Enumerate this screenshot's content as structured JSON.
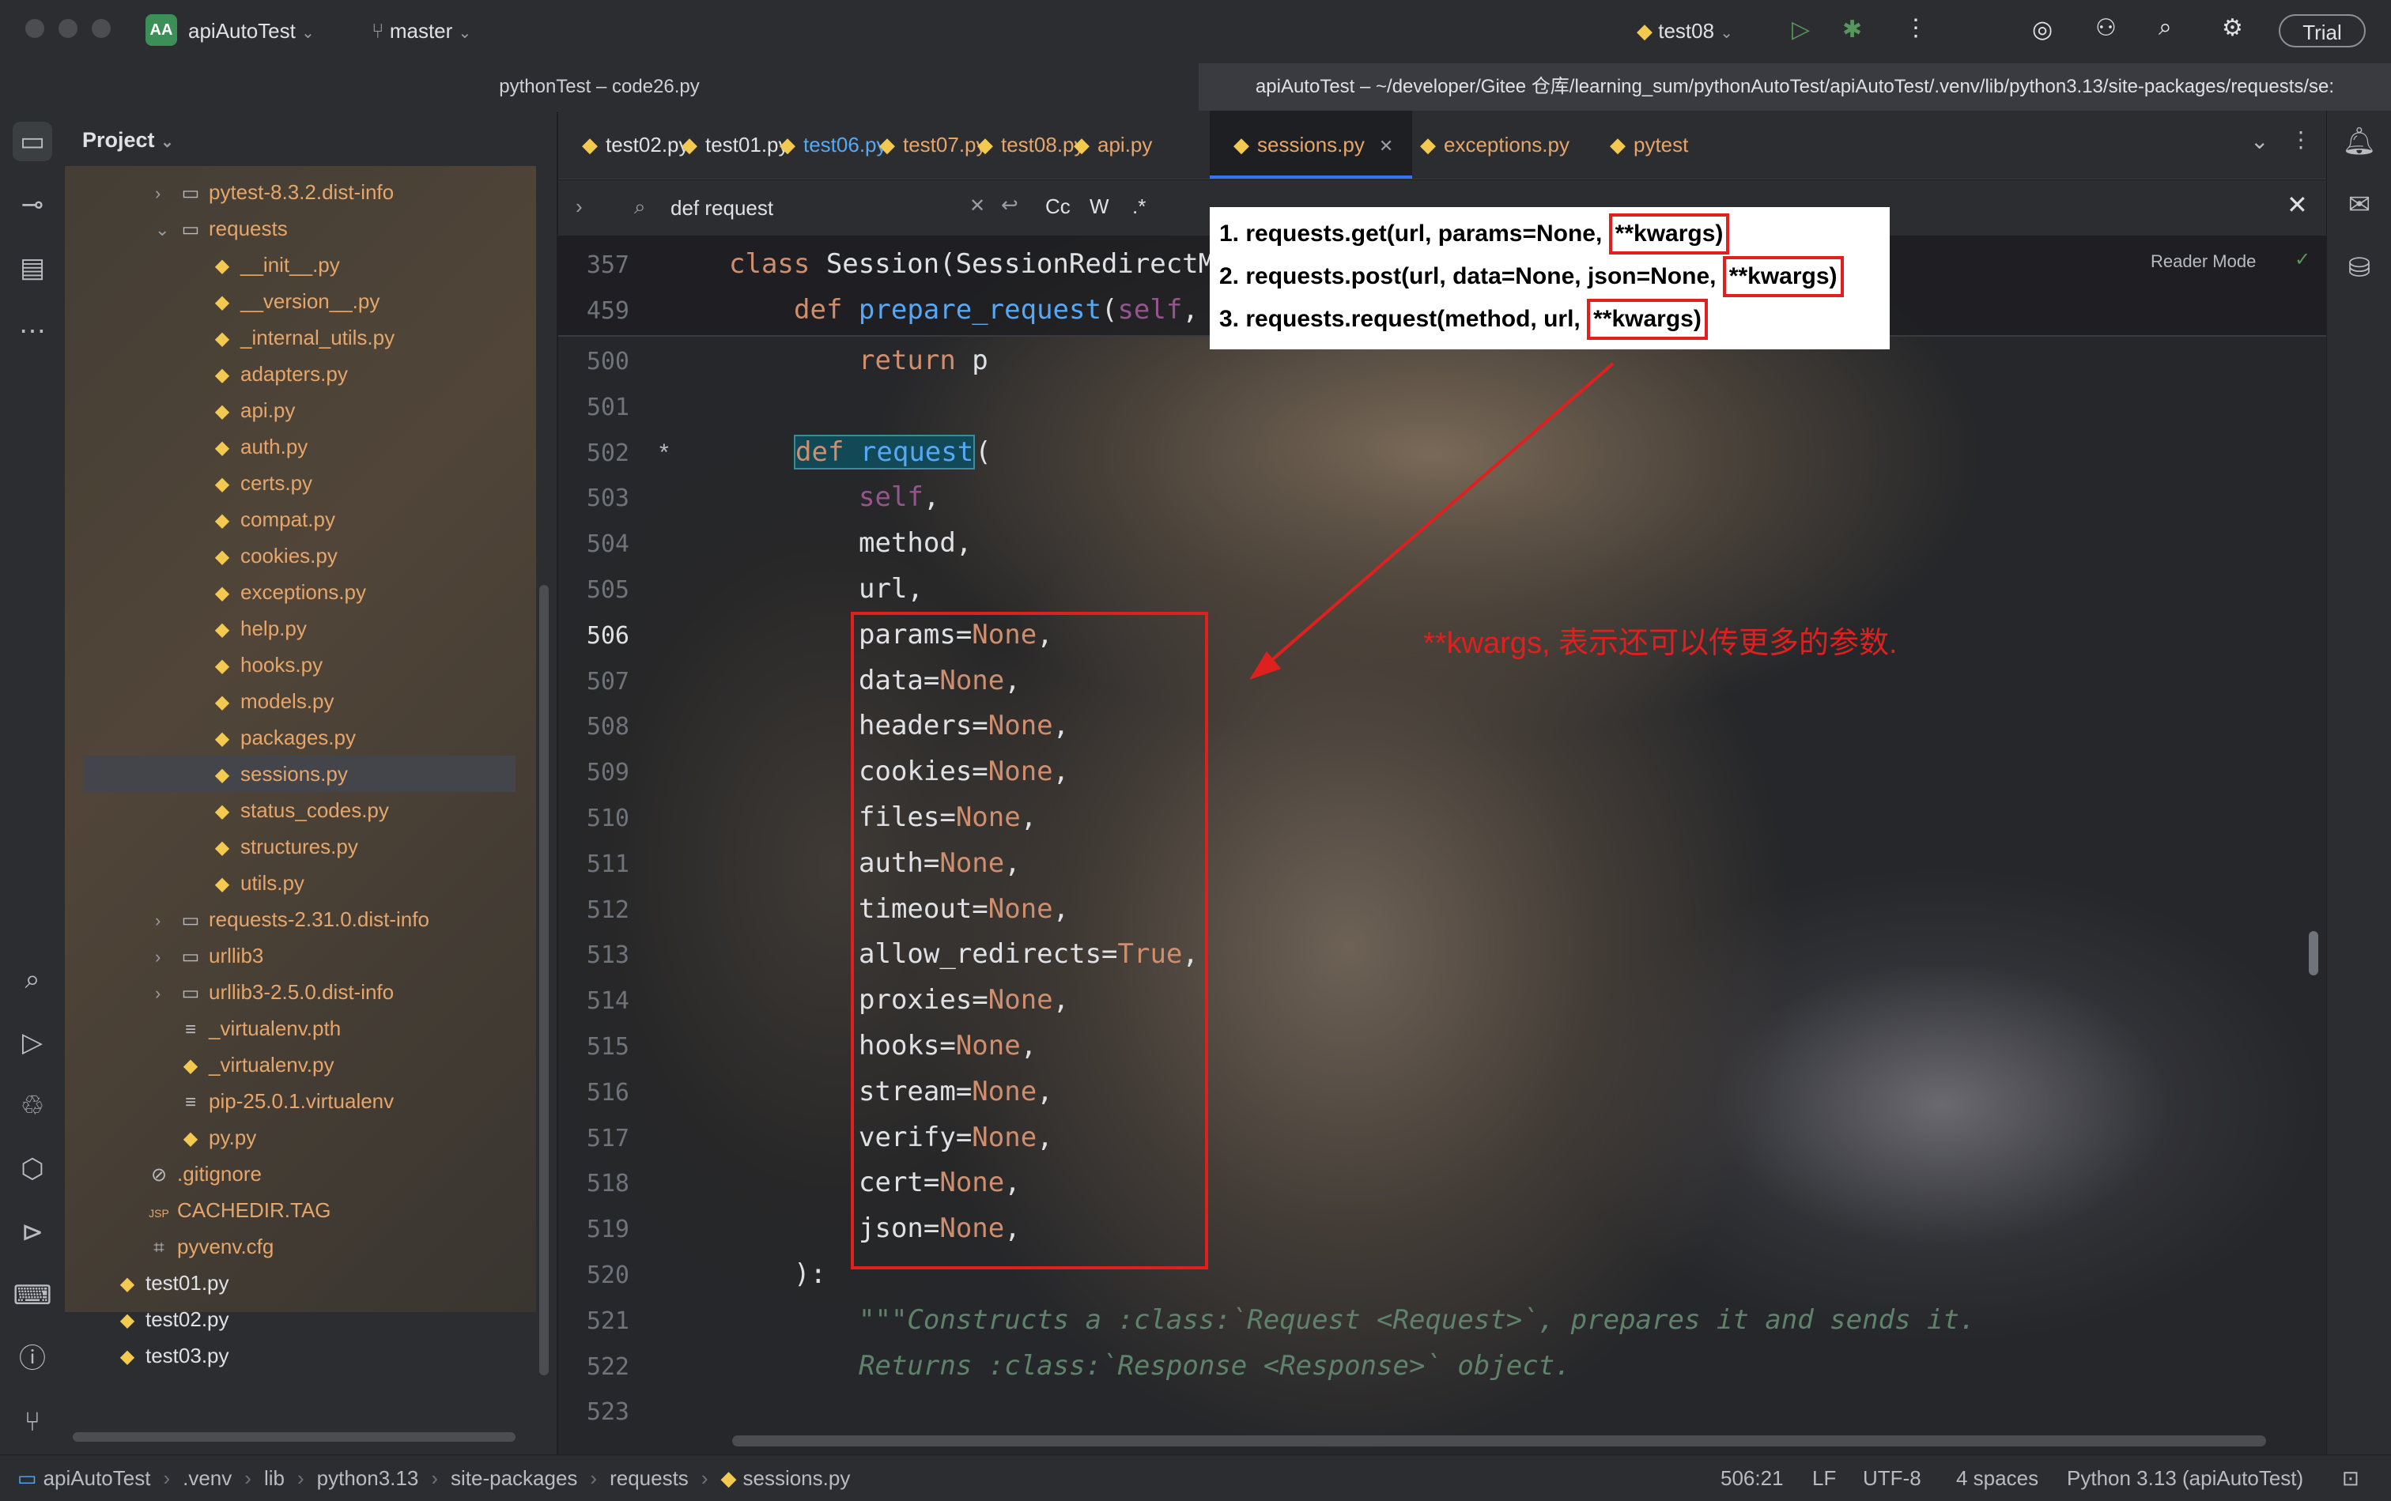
{
  "titlebar": {
    "project_badge": "AA",
    "project_name": "apiAutoTest",
    "branch": "master",
    "run_config": "test08",
    "trial_label": "Trial"
  },
  "window_tabs": [
    "pythonTest – code26.py",
    "apiAutoTest – ~/developer/Gitee 仓库/learning_sum/pythonAutoTest/apiAutoTest/.venv/lib/python3.13/site-packages/requests/se:"
  ],
  "project_panel": {
    "title": "Project",
    "items": [
      {
        "label": "pytest-8.3.2.dist-info",
        "type": "folder",
        "indent": 1,
        "chevron": "›"
      },
      {
        "label": "requests",
        "type": "folder",
        "indent": 1,
        "chevron": "⌄"
      },
      {
        "label": "__init__.py",
        "type": "py",
        "indent": 2
      },
      {
        "label": "__version__.py",
        "type": "py",
        "indent": 2
      },
      {
        "label": "_internal_utils.py",
        "type": "py",
        "indent": 2
      },
      {
        "label": "adapters.py",
        "type": "py",
        "indent": 2
      },
      {
        "label": "api.py",
        "type": "py",
        "indent": 2
      },
      {
        "label": "auth.py",
        "type": "py",
        "indent": 2
      },
      {
        "label": "certs.py",
        "type": "py",
        "indent": 2
      },
      {
        "label": "compat.py",
        "type": "py",
        "indent": 2
      },
      {
        "label": "cookies.py",
        "type": "py",
        "indent": 2
      },
      {
        "label": "exceptions.py",
        "type": "py",
        "indent": 2
      },
      {
        "label": "help.py",
        "type": "py",
        "indent": 2
      },
      {
        "label": "hooks.py",
        "type": "py",
        "indent": 2
      },
      {
        "label": "models.py",
        "type": "py",
        "indent": 2
      },
      {
        "label": "packages.py",
        "type": "py",
        "indent": 2
      },
      {
        "label": "sessions.py",
        "type": "py",
        "indent": 2,
        "selected": true
      },
      {
        "label": "status_codes.py",
        "type": "py",
        "indent": 2
      },
      {
        "label": "structures.py",
        "type": "py",
        "indent": 2
      },
      {
        "label": "utils.py",
        "type": "py",
        "indent": 2
      },
      {
        "label": "requests-2.31.0.dist-info",
        "type": "folder",
        "indent": 1,
        "chevron": "›"
      },
      {
        "label": "urllib3",
        "type": "folder",
        "indent": 1,
        "chevron": "›"
      },
      {
        "label": "urllib3-2.5.0.dist-info",
        "type": "folder",
        "indent": 1,
        "chevron": "›"
      },
      {
        "label": "_virtualenv.pth",
        "type": "text",
        "indent": 1
      },
      {
        "label": "_virtualenv.py",
        "type": "py",
        "indent": 1
      },
      {
        "label": "pip-25.0.1.virtualenv",
        "type": "text",
        "indent": 1
      },
      {
        "label": "py.py",
        "type": "py",
        "indent": 1
      },
      {
        "label": ".gitignore",
        "type": "ignore",
        "indent": 0
      },
      {
        "label": "CACHEDIR.TAG",
        "type": "tag",
        "indent": 0
      },
      {
        "label": "pyvenv.cfg",
        "type": "cfg",
        "indent": 0
      },
      {
        "label": "test01.py",
        "type": "py",
        "indent": -1,
        "white": true
      },
      {
        "label": "test02.py",
        "type": "py",
        "indent": -1,
        "white": true
      },
      {
        "label": "test03.py",
        "type": "py",
        "indent": -1,
        "white": true
      }
    ]
  },
  "editor_tabs": [
    {
      "label": "test02.py",
      "color": "#dfe1e5"
    },
    {
      "label": "test01.py",
      "color": "#dfe1e5"
    },
    {
      "label": "test06.py",
      "color": "#56a8f5"
    },
    {
      "label": "test07.py",
      "color": "#e6a66a"
    },
    {
      "label": "test08.py",
      "color": "#e6a66a"
    },
    {
      "label": "api.py",
      "color": "#e6a66a"
    },
    {
      "label": "sessions.py",
      "color": "#e6a66a",
      "active": true
    },
    {
      "label": "exceptions.py",
      "color": "#e6a66a"
    },
    {
      "label": "pytest",
      "color": "#e6a66a"
    }
  ],
  "find": {
    "query": "def request",
    "opt_case": "Cc",
    "opt_word": "W",
    "opt_regex": ".*"
  },
  "editor": {
    "reader_mode": "Reader Mode",
    "lines": [
      {
        "no": "357",
        "code": "class Session(SessionRedirectM"
      },
      {
        "no": "459",
        "code": "def prepare_request(self,"
      },
      {
        "no": "500",
        "code": "return p"
      },
      {
        "no": "501",
        "code": ""
      },
      {
        "no": "502",
        "code": "def request("
      },
      {
        "no": "503",
        "code": "self,"
      },
      {
        "no": "504",
        "code": "method,"
      },
      {
        "no": "505",
        "code": "url,"
      },
      {
        "no": "506",
        "code": "params=None,"
      },
      {
        "no": "507",
        "code": "data=None,"
      },
      {
        "no": "508",
        "code": "headers=None,"
      },
      {
        "no": "509",
        "code": "cookies=None,"
      },
      {
        "no": "510",
        "code": "files=None,"
      },
      {
        "no": "511",
        "code": "auth=None,"
      },
      {
        "no": "512",
        "code": "timeout=None,"
      },
      {
        "no": "513",
        "code": "allow_redirects=True,"
      },
      {
        "no": "514",
        "code": "proxies=None,"
      },
      {
        "no": "515",
        "code": "hooks=None,"
      },
      {
        "no": "516",
        "code": "stream=None,"
      },
      {
        "no": "517",
        "code": "verify=None,"
      },
      {
        "no": "518",
        "code": "cert=None,"
      },
      {
        "no": "519",
        "code": "json=None,"
      },
      {
        "no": "520",
        "code": "):"
      },
      {
        "no": "521",
        "code": "\"\"\"Constructs a :class:`Request <Request>`, prepares it and sends it."
      },
      {
        "no": "522",
        "code": "Returns :class:`Response <Response>` object."
      },
      {
        "no": "523",
        "code": ""
      }
    ],
    "modified_marker": "*"
  },
  "annotation": {
    "lines": [
      {
        "prefix": "1. requests.get(url, params=None, ",
        "boxed": "**kwargs)"
      },
      {
        "prefix": "2. requests.post(url, data=None, json=None, ",
        "boxed": "**kwargs)"
      },
      {
        "prefix": "3. requests.request(method, url, ",
        "boxed": "**kwargs)"
      }
    ],
    "note": "**kwargs, 表示还可以传更多的参数."
  },
  "statusbar": {
    "breadcrumbs": [
      "apiAutoTest",
      ".venv",
      "lib",
      "python3.13",
      "site-packages",
      "requests",
      "sessions.py"
    ],
    "position": "506:21",
    "line_ending": "LF",
    "encoding": "UTF-8",
    "indent": "4 spaces",
    "interpreter": "Python 3.13 (apiAutoTest)"
  },
  "colors": {
    "accent": "#3574f0",
    "annotation_red": "#e0201f",
    "keyword": "#cf8e6d",
    "function": "#56a8f5"
  }
}
